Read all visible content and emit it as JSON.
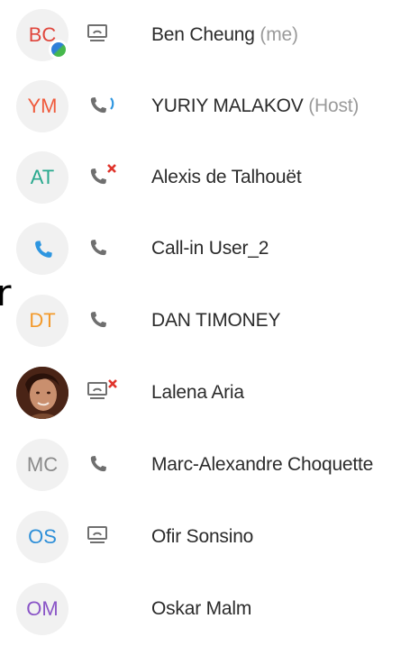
{
  "stray_text": "r",
  "participants": [
    {
      "initials": "BC",
      "initials_color": "#e0463c",
      "name": "Ben Cheung",
      "role": "(me)",
      "status_icon": "screen-share-icon",
      "badge": "presence-badge-icon"
    },
    {
      "initials": "YM",
      "initials_color": "#f05a3c",
      "name": "YURIY MALAKOV",
      "role": "(Host)",
      "status_icon": "phone-speaking-icon"
    },
    {
      "initials": "AT",
      "initials_color": "#29a98e",
      "name": "Alexis de Talhouët",
      "role": "",
      "status_icon": "phone-muted-icon"
    },
    {
      "initials": "",
      "initials_color": "#2e96e0",
      "name": "Call-in User_2",
      "role": "",
      "status_icon": "phone-icon",
      "avatar_icon": "phone-avatar-icon"
    },
    {
      "initials": "DT",
      "initials_color": "#f39a2c",
      "name": "DAN TIMONEY",
      "role": "",
      "status_icon": "phone-icon"
    },
    {
      "initials": "",
      "initials_color": "#5a2d1c",
      "name": "Lalena Aria",
      "role": "",
      "status_icon": "screen-share-muted-icon",
      "avatar_photo": "profile-photo"
    },
    {
      "initials": "MC",
      "initials_color": "#8a8a8a",
      "name": "Marc-Alexandre Choquette",
      "role": "",
      "status_icon": "phone-icon"
    },
    {
      "initials": "OS",
      "initials_color": "#2e8fd8",
      "name": "Ofir Sonsino",
      "role": "",
      "status_icon": "screen-share-icon"
    },
    {
      "initials": "OM",
      "initials_color": "#8a55c7",
      "name": "Oskar Malm",
      "role": "",
      "status_icon": ""
    }
  ]
}
